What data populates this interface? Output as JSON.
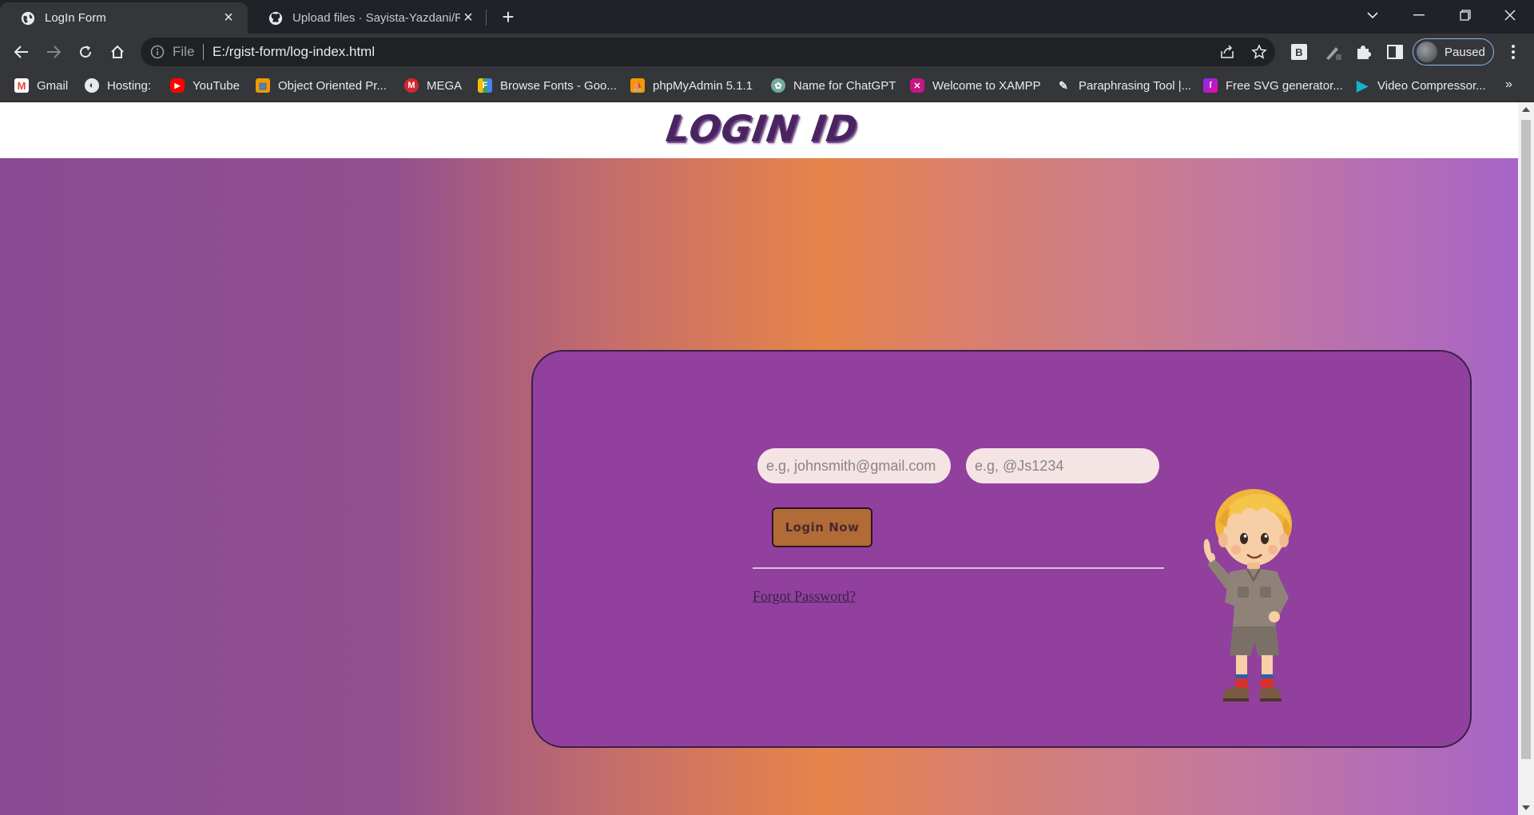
{
  "browser": {
    "tabs": [
      {
        "title": "LogIn Form",
        "active": true,
        "favicon": "globe-icon"
      },
      {
        "title": "Upload files · Sayista-Yazdani/Reg",
        "active": false,
        "favicon": "github-icon"
      }
    ],
    "address": {
      "scheme_label": "File",
      "url": "E:/rgist-form/log-index.html"
    },
    "profile_label": "Paused",
    "bookmarks": [
      {
        "label": "Gmail",
        "icon": "gmail-icon"
      },
      {
        "label": "Hosting:",
        "icon": "globe-icon"
      },
      {
        "label": "YouTube",
        "icon": "youtube-icon"
      },
      {
        "label": "Object Oriented Pr...",
        "icon": "book-icon"
      },
      {
        "label": "MEGA",
        "icon": "mega-icon"
      },
      {
        "label": "Browse Fonts - Goo...",
        "icon": "google-fonts-icon"
      },
      {
        "label": "phpMyAdmin 5.1.1",
        "icon": "phpmyadmin-icon"
      },
      {
        "label": "Name for ChatGPT",
        "icon": "chatgpt-icon"
      },
      {
        "label": "Welcome to XAMPP",
        "icon": "xampp-icon"
      },
      {
        "label": "Paraphrasing Tool |...",
        "icon": "feather-icon"
      },
      {
        "label": "Free SVG generator...",
        "icon": "svg-generator-icon"
      },
      {
        "label": "Video Compressor...",
        "icon": "play-icon"
      }
    ]
  },
  "page": {
    "title": "LOGIN ID",
    "email_placeholder": "e.g, johnsmith@gmail.com",
    "password_placeholder": "e.g, @Js1234",
    "login_button": "Login Now",
    "forgot_link": "Forgot Password?"
  },
  "colors": {
    "card": "#91409e",
    "button": "#b16b37",
    "title": "#4a2460",
    "field": "#f5e4e4"
  }
}
